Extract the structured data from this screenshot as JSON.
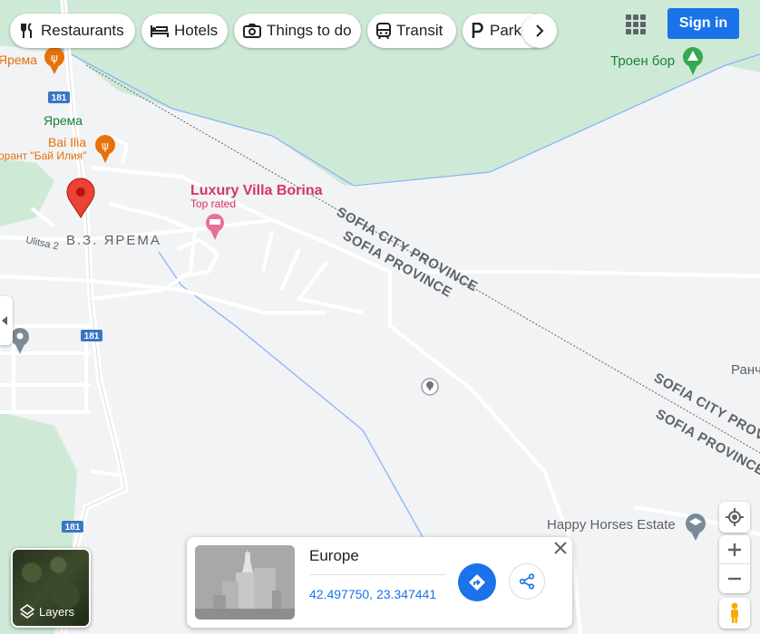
{
  "categories": [
    {
      "label": "Restaurants",
      "icon": "restaurant-icon"
    },
    {
      "label": "Hotels",
      "icon": "hotel-icon"
    },
    {
      "label": "Things to do",
      "icon": "camera-icon"
    },
    {
      "label": "Transit",
      "icon": "transit-icon"
    },
    {
      "label": "Park",
      "icon": "parking-icon"
    }
  ],
  "header": {
    "signin_label": "Sign in",
    "apps_icon": "apps-grid-icon"
  },
  "map_labels": {
    "yarema_top": "Ярема",
    "road_181": "181",
    "yarema": "Ярема",
    "bai_ilia": "Bai Ilia",
    "restaurant_bai": "орант \"Бай Илия\"",
    "villa_name": "Luxury Villa Borina",
    "villa_sub": "Top rated",
    "vz_yarema": "В.З. ЯРЕМА",
    "ulitsa2": "Ulitsa 2",
    "troen_bor": "Троен бор",
    "sofia_city_1": "SOFIA CITY PROVINCE",
    "sofia_prov_1": "SOFIA PROVINCE",
    "sofia_city_2": "SOFIA CITY PROV",
    "sofia_prov_2": "SOFIA PROVINCE",
    "ranch": "Ранч",
    "happy_horses": "Happy Horses Estate"
  },
  "layers": {
    "label": "Layers"
  },
  "place_card": {
    "title": "Europe",
    "coords": "42.497750, 23.347441",
    "directions_icon": "directions-icon",
    "share_icon": "share-icon",
    "close_icon": "close-icon"
  },
  "colors": {
    "accent": "#1a73e8",
    "park": "#ceead6",
    "boundary": "#8ab4f8",
    "pin_red": "#ea4335",
    "hotel_pink": "#d6336c",
    "food_orange": "#e8710a",
    "park_green": "#188038"
  }
}
